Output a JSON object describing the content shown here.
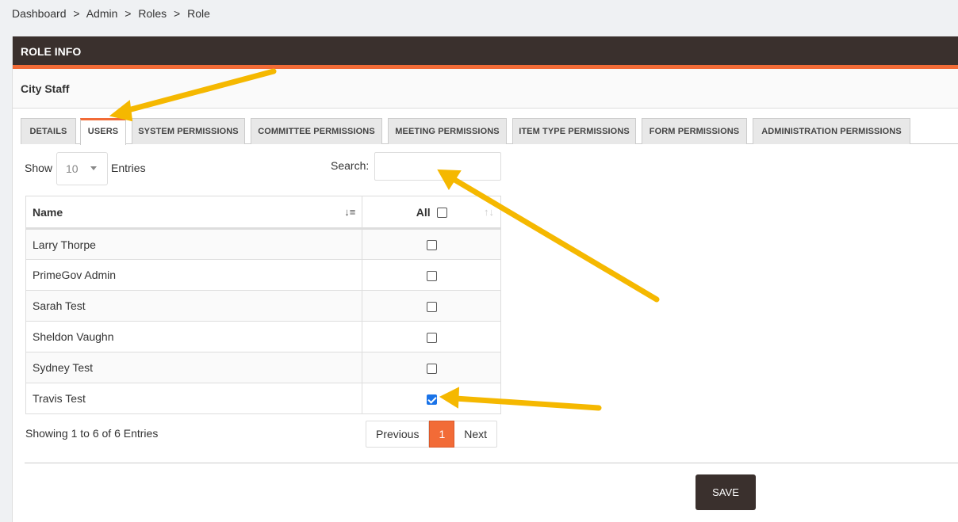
{
  "breadcrumb": [
    "Dashboard",
    "Admin",
    "Roles",
    "Role"
  ],
  "breadcrumb_sep": ">",
  "panel": {
    "title": "ROLE INFO",
    "role_name": "City Staff"
  },
  "tabs": [
    {
      "label": "DETAILS",
      "active": false
    },
    {
      "label": "USERS",
      "active": true
    },
    {
      "label": "SYSTEM PERMISSIONS",
      "active": false
    },
    {
      "label": "COMMITTEE PERMISSIONS",
      "active": false
    },
    {
      "label": "MEETING PERMISSIONS",
      "active": false
    },
    {
      "label": "ITEM TYPE PERMISSIONS",
      "active": false
    },
    {
      "label": "FORM PERMISSIONS",
      "active": false
    },
    {
      "label": "ADMINISTRATION PERMISSIONS",
      "active": false
    }
  ],
  "controls": {
    "show_label": "Show",
    "entries_value": "10",
    "entries_label": "Entries",
    "search_label": "Search:",
    "search_value": ""
  },
  "table": {
    "headers": {
      "name": "Name",
      "all": "All"
    },
    "rows": [
      {
        "name": "Larry Thorpe",
        "checked": false
      },
      {
        "name": "PrimeGov Admin",
        "checked": false
      },
      {
        "name": "Sarah Test",
        "checked": false
      },
      {
        "name": "Sheldon Vaughn",
        "checked": false
      },
      {
        "name": "Sydney Test",
        "checked": false
      },
      {
        "name": "Travis Test",
        "checked": true
      }
    ]
  },
  "footer": {
    "info": "Showing 1 to 6 of 6 Entries",
    "previous": "Previous",
    "page": "1",
    "next": "Next"
  },
  "actions": {
    "save": "SAVE"
  },
  "colors": {
    "accent": "#f26b37",
    "header_bg": "#3a302d",
    "annotation_arrow": "#f5b800",
    "checkbox_checked": "#1a73e8"
  }
}
